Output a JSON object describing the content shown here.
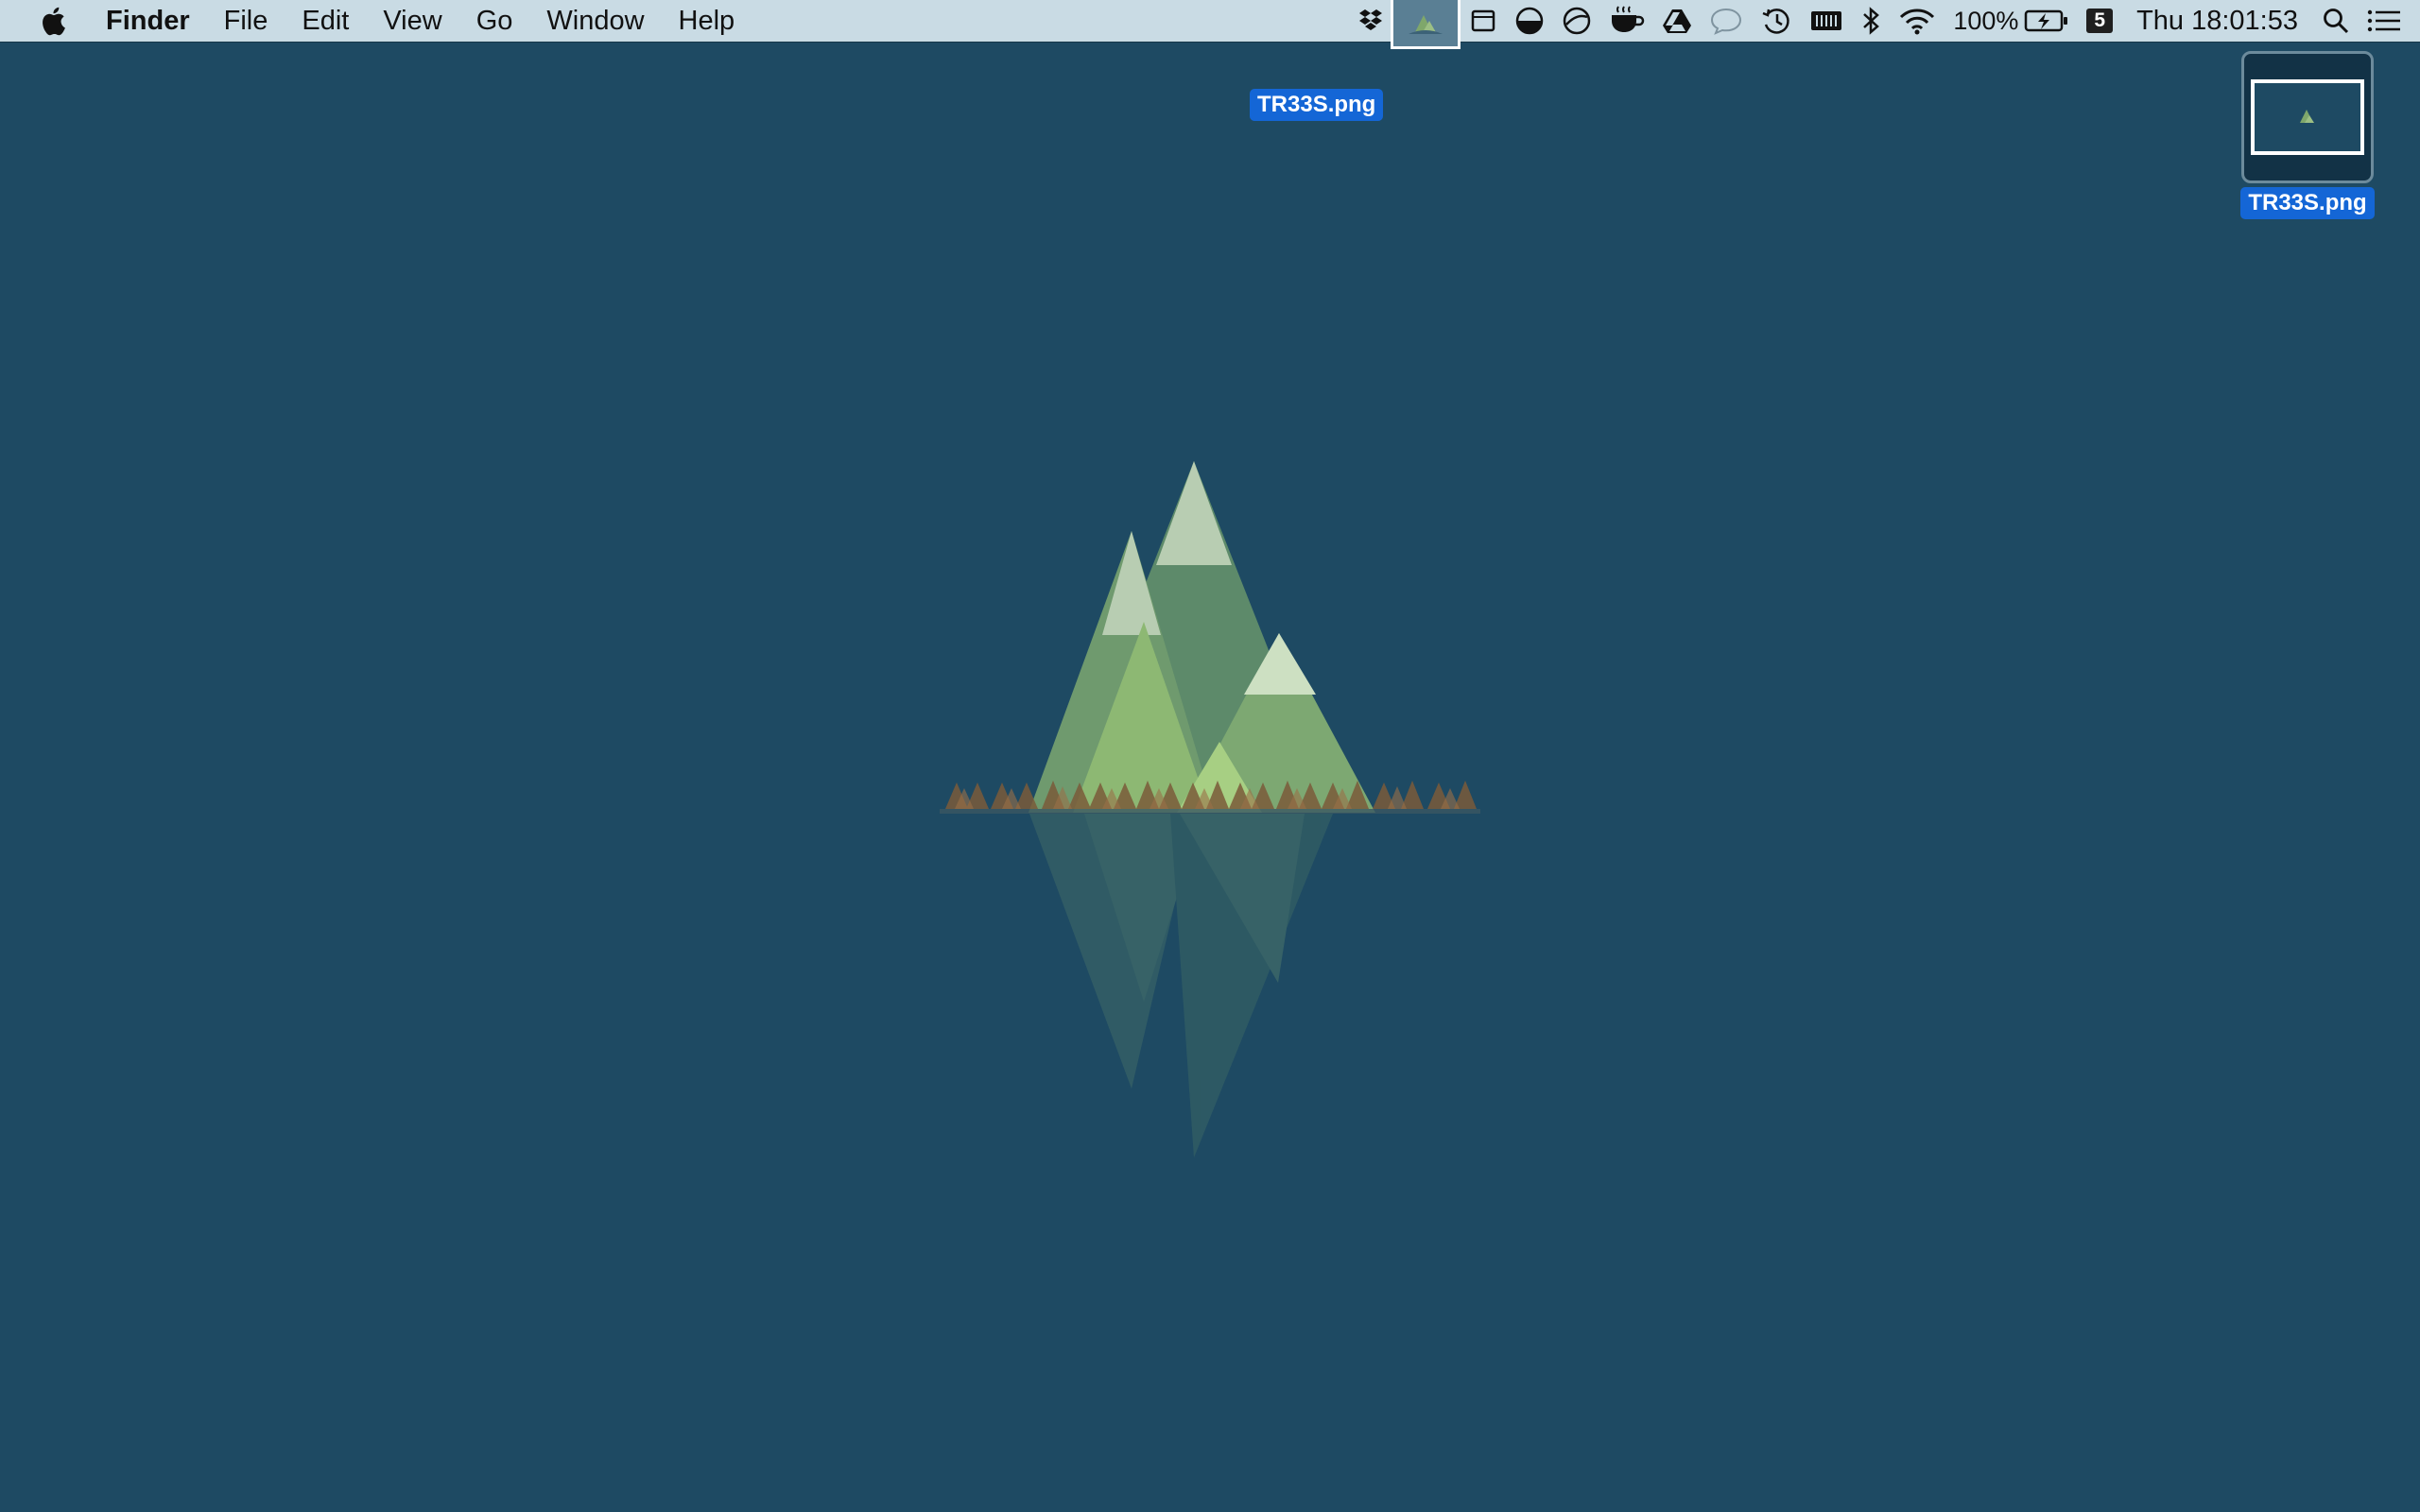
{
  "menubar": {
    "app_name": "Finder",
    "menus": [
      "File",
      "Edit",
      "View",
      "Go",
      "Window",
      "Help"
    ],
    "status": {
      "battery_percent": "100%",
      "notification_count": "5",
      "clock": "Thu 18:01:53"
    }
  },
  "drag": {
    "filename": "TR33S.png"
  },
  "desktop": {
    "icons": [
      {
        "label": "TR33S.png"
      }
    ]
  },
  "colors": {
    "desktop_background": "#1e4a63",
    "menubar_background": "#c9dbe4",
    "selection_blue": "#1466d6",
    "mountain_green": "#7fa76b",
    "tree_brown": "#7a5a3a"
  }
}
